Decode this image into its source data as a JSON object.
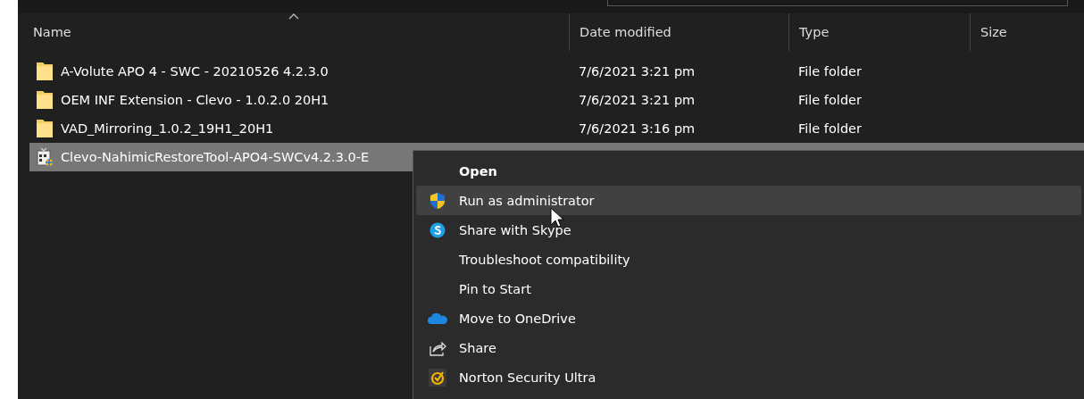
{
  "columns": [
    {
      "label": "Name",
      "sorted": true
    },
    {
      "label": "Date modified",
      "sorted": false
    },
    {
      "label": "Type",
      "sorted": false
    },
    {
      "label": "Size",
      "sorted": false
    }
  ],
  "rows": [
    {
      "kind": "folder",
      "name": "A-Volute APO 4 - SWC - 20210526 4.2.3.0",
      "date": "7/6/2021 3:21 pm",
      "type": "File folder",
      "selected": false
    },
    {
      "kind": "folder",
      "name": "OEM INF Extension - Clevo - 1.0.2.0 20H1",
      "date": "7/6/2021 3:21 pm",
      "type": "File folder",
      "selected": false
    },
    {
      "kind": "folder",
      "name": "VAD_Mirroring_1.0.2_19H1_20H1",
      "date": "7/6/2021 3:16 pm",
      "type": "File folder",
      "selected": false
    },
    {
      "kind": "installer",
      "name": "Clevo-NahimicRestoreTool-APO4-SWCv4.2.3.0-E",
      "selected": true
    }
  ],
  "context_menu": {
    "items": [
      {
        "kind": "plain",
        "label": "Open",
        "default": true,
        "highlighted": false
      },
      {
        "kind": "shield",
        "label": "Run as administrator",
        "default": false,
        "highlighted": true
      },
      {
        "kind": "skype",
        "label": "Share with Skype",
        "default": false,
        "highlighted": false
      },
      {
        "kind": "plain",
        "label": "Troubleshoot compatibility",
        "default": false,
        "highlighted": false
      },
      {
        "kind": "plain",
        "label": "Pin to Start",
        "default": false,
        "highlighted": false
      },
      {
        "kind": "cloud",
        "label": "Move to OneDrive",
        "default": false,
        "highlighted": false
      },
      {
        "kind": "share",
        "label": "Share",
        "default": false,
        "highlighted": false
      },
      {
        "kind": "norton",
        "label": "Norton Security Ultra",
        "default": false,
        "highlighted": false
      }
    ]
  }
}
